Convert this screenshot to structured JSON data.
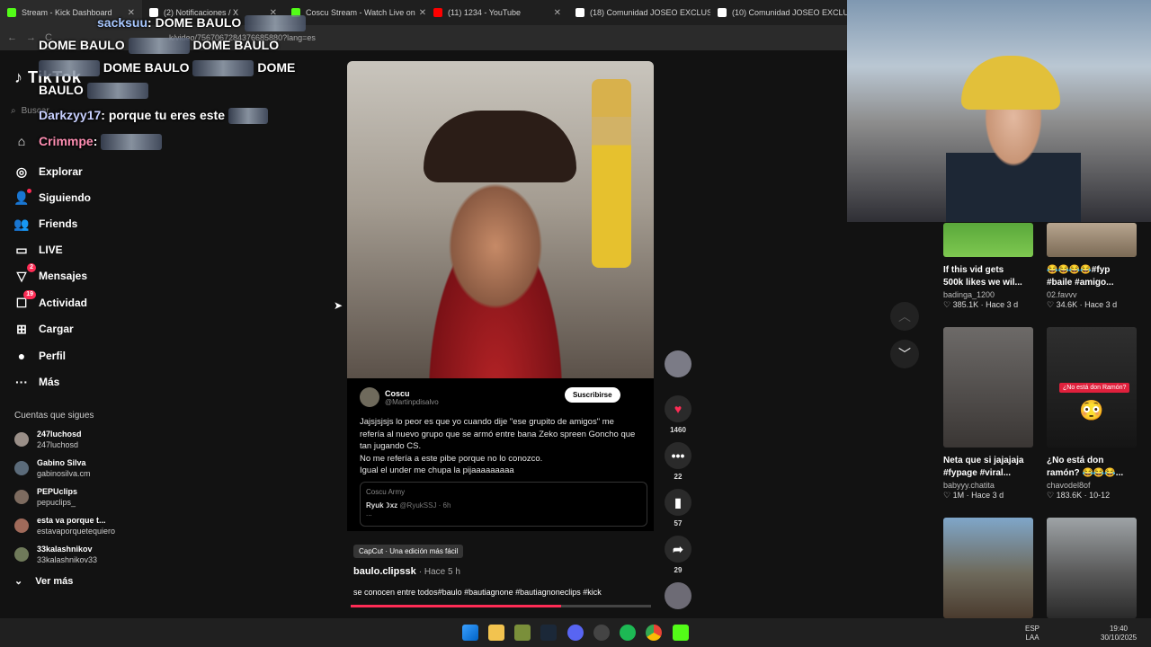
{
  "browser": {
    "tabs": [
      {
        "label": "Stream - Kick Dashboard",
        "color": "#53fc18"
      },
      {
        "label": "(2) Notificaciones / X",
        "color": "#ffffff"
      },
      {
        "label": "Coscu Stream - Watch Live on",
        "color": "#53fc18"
      },
      {
        "label": "(11) 1234 - YouTube",
        "color": "#ff0000"
      },
      {
        "label": "(18) Comunidad JOSEO EXCLUS",
        "color": "#ffffff"
      },
      {
        "label": "(10) Comunidad JOSEO EXCLU",
        "color": "#ffffff"
      }
    ],
    "close_glyph": "✕",
    "url": "k/video/7567067284376685880?lang=es"
  },
  "sidebar": {
    "logo": "TikTok",
    "search_placeholder": "Buscar",
    "items": [
      {
        "label": "Explorar",
        "icon": "compass-icon",
        "glyph": "◎"
      },
      {
        "label": "Siguiendo",
        "icon": "following-icon",
        "glyph": "👤"
      },
      {
        "label": "Friends",
        "icon": "friends-icon",
        "glyph": "👥"
      },
      {
        "label": "LIVE",
        "icon": "live-icon",
        "glyph": "▭"
      },
      {
        "label": "Mensajes",
        "icon": "messages-icon",
        "glyph": "▽",
        "badge": "2"
      },
      {
        "label": "Actividad",
        "icon": "activity-icon",
        "glyph": "☐",
        "badge": "19"
      },
      {
        "label": "Cargar",
        "icon": "upload-icon",
        "glyph": "⊞"
      },
      {
        "label": "Perfil",
        "icon": "profile-icon",
        "glyph": "●"
      },
      {
        "label": "Más",
        "icon": "more-icon",
        "glyph": "···"
      }
    ],
    "follows_title": "Cuentas que sigues",
    "follows": [
      {
        "name": "247luchosd",
        "handle": "247luchosd"
      },
      {
        "name": "Gabino Silva",
        "handle": "gabinosilva.cm"
      },
      {
        "name": "PEPUclips",
        "handle": "pepuclips_"
      },
      {
        "name": "esta va porque t...",
        "handle": "estavaporquetequiero"
      },
      {
        "name": "33kalashnikov",
        "handle": "33kalashnikov33"
      }
    ],
    "see_more": "Ver más"
  },
  "post": {
    "tweet_author": "Coscu",
    "tweet_handle": "@Martinpdisalvo",
    "subscribe": "Suscribirse",
    "tweet_lines": [
      "Jajsjsjsjs lo peor es que yo cuando dije \"ese grupito de amigos\" me",
      "refería al nuevo grupo que se armó entre bana Zeko spreen Goncho que",
      "tan jugando CS.",
      "No me refería a este pibe porque no lo conozco.",
      "Igual el under me chupa la pijaaaaaaaaa"
    ],
    "quote_label": "Coscu Army",
    "quote_user": "Ryuk☽xz",
    "quote_handle": "@RyukSSJ · 6h",
    "quote_more": "...",
    "capcut": "CapCut · Una edición más fácil",
    "author": "baulo.clipssk",
    "time": "· Hace 5 h",
    "caption": "se conocen entre todos#baulo #bautiagnone #bautiagnoneclips #kick",
    "progress": 0.7
  },
  "actions": {
    "likes": "1460",
    "comments": "22",
    "saves": "57",
    "shares": "29"
  },
  "grid": [
    {
      "title1": "If this vid gets",
      "title2": "500k likes we wil...",
      "user": "badinga_1200",
      "meta": "♡ 385.1K · Hace 3 d"
    },
    {
      "title1": "😂😂😂😂#fyp",
      "title2": "#baile #amigo...",
      "user": "02.favvv",
      "meta": "♡ 34.6K · Hace 3 d"
    },
    {
      "title1": "Neta que si jajajaja",
      "title2": "#fypage #viral...",
      "user": "babyyy.chatita",
      "meta": "♡ 1M · Hace 3 d"
    },
    {
      "title1": "¿No está don",
      "title2": "ramón? 😂😂😂...",
      "user": "chavodel8of",
      "meta": "♡ 183.6K · 10-12"
    }
  ],
  "thumb_overlay": "¿No está don Ramón?",
  "chat": {
    "line1_user": "sacksuu",
    "line1_text": ": DOME BAULO",
    "spam": [
      "DOME BAULO",
      "DOME BAULO",
      "DOME BAULO",
      "DOME",
      "BAULO"
    ],
    "line2_user": "Darkzyy17",
    "line2_text": ": porque tu eres este",
    "line3_user": "Crimmpe",
    "line3_text": ":"
  },
  "taskbar": {
    "lang1": "ESP",
    "lang2": "LAA",
    "time": "19:40",
    "date": "30/10/2025"
  }
}
